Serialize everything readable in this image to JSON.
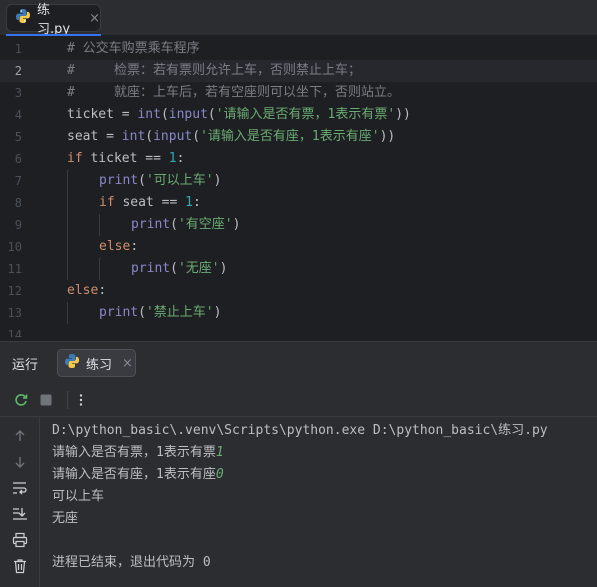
{
  "editor_tab": {
    "file_name": "练习.py",
    "close": "×"
  },
  "code_lines": [
    {
      "n": "1",
      "tokens": [
        {
          "c": "t-cm",
          "t": "# 公交车购票乘车程序"
        }
      ]
    },
    {
      "n": "2",
      "active": true,
      "tokens": [
        {
          "c": "t-cm",
          "t": "#     检票：若有票则允许上车，否则禁止上车；"
        }
      ]
    },
    {
      "n": "3",
      "tokens": [
        {
          "c": "t-cm",
          "t": "#     就座：上车后，若有空座则可以坐下，否则站立。"
        }
      ]
    },
    {
      "n": "4",
      "tokens": [
        {
          "c": "t-id",
          "t": "ticket = "
        },
        {
          "c": "t-fn",
          "t": "int"
        },
        {
          "c": "t-id",
          "t": "("
        },
        {
          "c": "t-fn",
          "t": "input"
        },
        {
          "c": "t-id",
          "t": "("
        },
        {
          "c": "t-str",
          "t": "'请输入是否有票，1表示有票'"
        },
        {
          "c": "t-id",
          "t": "))"
        }
      ]
    },
    {
      "n": "5",
      "tokens": [
        {
          "c": "t-id",
          "t": "seat = "
        },
        {
          "c": "t-fn",
          "t": "int"
        },
        {
          "c": "t-id",
          "t": "("
        },
        {
          "c": "t-fn",
          "t": "input"
        },
        {
          "c": "t-id",
          "t": "("
        },
        {
          "c": "t-str",
          "t": "'请输入是否有座，1表示有座'"
        },
        {
          "c": "t-id",
          "t": "))"
        }
      ]
    },
    {
      "n": "6",
      "tokens": [
        {
          "c": "t-kw",
          "t": "if "
        },
        {
          "c": "t-id",
          "t": "ticket == "
        },
        {
          "c": "t-num",
          "t": "1"
        },
        {
          "c": "t-id",
          "t": ":"
        }
      ]
    },
    {
      "n": "7",
      "indent": 1,
      "tokens": [
        {
          "c": "t-fn",
          "t": "print"
        },
        {
          "c": "t-id",
          "t": "("
        },
        {
          "c": "t-str",
          "t": "'可以上车'"
        },
        {
          "c": "t-id",
          "t": ")"
        }
      ]
    },
    {
      "n": "8",
      "indent": 1,
      "tokens": [
        {
          "c": "t-kw",
          "t": "if "
        },
        {
          "c": "t-id",
          "t": "seat == "
        },
        {
          "c": "t-num",
          "t": "1"
        },
        {
          "c": "t-id",
          "t": ":"
        }
      ]
    },
    {
      "n": "9",
      "indent": 2,
      "tokens": [
        {
          "c": "t-fn",
          "t": "print"
        },
        {
          "c": "t-id",
          "t": "("
        },
        {
          "c": "t-str",
          "t": "'有空座'"
        },
        {
          "c": "t-id",
          "t": ")"
        }
      ]
    },
    {
      "n": "10",
      "indent": 1,
      "tokens": [
        {
          "c": "t-kw",
          "t": "else"
        },
        {
          "c": "t-id",
          "t": ":"
        }
      ]
    },
    {
      "n": "11",
      "indent": 2,
      "tokens": [
        {
          "c": "t-fn",
          "t": "print"
        },
        {
          "c": "t-id",
          "t": "("
        },
        {
          "c": "t-str",
          "t": "'无座'"
        },
        {
          "c": "t-id",
          "t": ")"
        }
      ]
    },
    {
      "n": "12",
      "tokens": [
        {
          "c": "t-kw",
          "t": "else"
        },
        {
          "c": "t-id",
          "t": ":"
        }
      ]
    },
    {
      "n": "13",
      "indent": 1,
      "tokens": [
        {
          "c": "t-fn",
          "t": "print"
        },
        {
          "c": "t-id",
          "t": "("
        },
        {
          "c": "t-str",
          "t": "'禁止上车'"
        },
        {
          "c": "t-id",
          "t": ")"
        }
      ]
    },
    {
      "n": "14",
      "tokens": []
    }
  ],
  "run_panel": {
    "title": "运行",
    "tab_label": "练习",
    "close": "×"
  },
  "console_output": [
    {
      "text": "D:\\python_basic\\.venv\\Scripts\\python.exe D:\\python_basic\\练习.py"
    },
    {
      "text": "请输入是否有票，1表示有票",
      "input": "1"
    },
    {
      "text": "请输入是否有座，1表示有座",
      "input": "0"
    },
    {
      "text": "可以上车"
    },
    {
      "text": "无座"
    },
    {
      "text": ""
    },
    {
      "text": "进程已结束，退出代码为 0"
    }
  ],
  "icons": {
    "rerun": "rerun-icon",
    "stop": "stop-icon",
    "more": "more-options-icon"
  }
}
